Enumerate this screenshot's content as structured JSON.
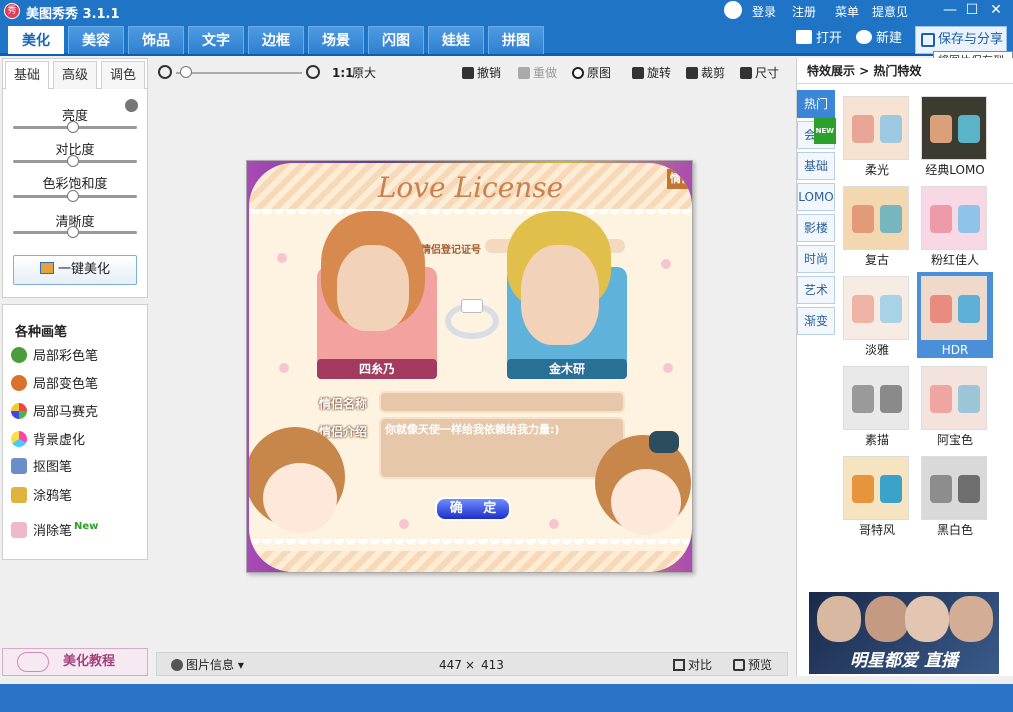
{
  "app": {
    "title": "美图秀秀 3.1.1",
    "logo_text": "秀"
  },
  "titlebar": {
    "login": "登录",
    "register": "注册",
    "menu": "菜单",
    "feedback": "提意见"
  },
  "tabs": [
    {
      "label": "美化",
      "active": true
    },
    {
      "label": "美容"
    },
    {
      "label": "饰品"
    },
    {
      "label": "文字"
    },
    {
      "label": "边框"
    },
    {
      "label": "场景"
    },
    {
      "label": "闪图"
    },
    {
      "label": "娃娃"
    },
    {
      "label": "拼图"
    }
  ],
  "actions": {
    "open": "打开",
    "new": "新建",
    "save_share": "保存与分享",
    "save_tooltip": "将图片保存到"
  },
  "left_panel": {
    "subtabs": [
      "基础",
      "高级",
      "调色"
    ],
    "sliders": [
      {
        "label": "亮度",
        "value": 0.5
      },
      {
        "label": "对比度",
        "value": 0.5
      },
      {
        "label": "色彩饱和度",
        "value": 0.5
      },
      {
        "label": "清晰度",
        "value": 0.5
      }
    ],
    "one_click": "一键美化"
  },
  "brushes": {
    "title": "各种画笔",
    "items": [
      {
        "label": "局部彩色笔",
        "icon": "color-brush-icon"
      },
      {
        "label": "局部变色笔",
        "icon": "recolor-brush-icon"
      },
      {
        "label": "局部马赛克",
        "icon": "mosaic-icon"
      },
      {
        "label": "背景虚化",
        "icon": "blur-icon"
      },
      {
        "label": "抠图笔",
        "icon": "cutout-icon"
      },
      {
        "label": "涂鸦笔",
        "icon": "doodle-icon"
      },
      {
        "label": "消除笔",
        "icon": "eraser-icon",
        "tag": "New"
      }
    ]
  },
  "tutorial": "美化教程",
  "toolbar": {
    "zoom_actual": "1:1",
    "zoom_original": "原大",
    "undo": "撤销",
    "redo": "重做",
    "original": "原图",
    "rotate": "旋转",
    "crop": "裁剪",
    "size": "尺寸"
  },
  "photo": {
    "title": "Love License",
    "tab_right": "情侣",
    "reg_label": "情侣登记证号",
    "name_female": "四糸乃",
    "name_male": "金木研",
    "label_name": "情侣名称",
    "label_intro": "情侣介绍",
    "intro_text": "你就像天使一样给我依赖给我力量:)",
    "confirm": "确 定"
  },
  "status": {
    "info": "图片信息",
    "width": "447",
    "sep": "×",
    "height": "413",
    "compare": "对比",
    "preview": "预览"
  },
  "right_panel": {
    "breadcrumb": "特效展示 > 热门特效",
    "categories": [
      {
        "label": "热门",
        "active": true
      },
      {
        "label": "会员",
        "new": "NEW"
      },
      {
        "label": "基础"
      },
      {
        "label": "LOMO"
      },
      {
        "label": "影楼"
      },
      {
        "label": "时尚"
      },
      {
        "label": "艺术"
      },
      {
        "label": "渐变"
      }
    ],
    "effects": [
      {
        "label": "柔光",
        "tone": "#f6e3d2"
      },
      {
        "label": "经典LOMO",
        "tone": "#3b3b30"
      },
      {
        "label": "复古",
        "tone": "#f2d7b0"
      },
      {
        "label": "粉红佳人",
        "tone": "#f8d8e4"
      },
      {
        "label": "淡雅",
        "tone": "#f7ece4"
      },
      {
        "label": "HDR",
        "tone": "#efd9cb",
        "selected": true
      },
      {
        "label": "素描",
        "tone": "#e9e9e9"
      },
      {
        "label": "阿宝色",
        "tone": "#f3e3dc"
      },
      {
        "label": "哥特风",
        "tone": "#f6e4c0"
      },
      {
        "label": "黑白色",
        "tone": "#d9d9d9"
      }
    ],
    "banner": "明星都爱  直播"
  }
}
